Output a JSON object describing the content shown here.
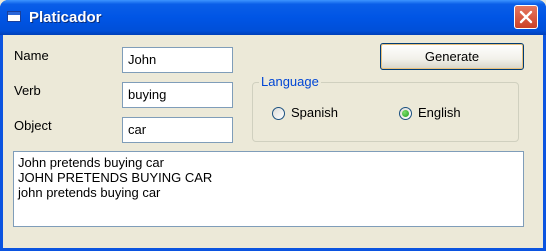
{
  "window": {
    "title": "Platicador"
  },
  "form": {
    "name_label": "Name",
    "name_value": "John",
    "verb_label": "Verb",
    "verb_value": "buying",
    "object_label": "Object",
    "object_value": "car"
  },
  "generate_label": "Generate",
  "language": {
    "legend": "Language",
    "options": [
      {
        "label": "Spanish",
        "checked": false
      },
      {
        "label": "English",
        "checked": true
      }
    ]
  },
  "output_lines": [
    "John pretends buying car",
    "JOHN PRETENDS BUYING CAR",
    "john pretends buying car"
  ],
  "colors": {
    "titlebar": "#0055e5",
    "legend": "#0046d5",
    "close": "#cc4127"
  }
}
